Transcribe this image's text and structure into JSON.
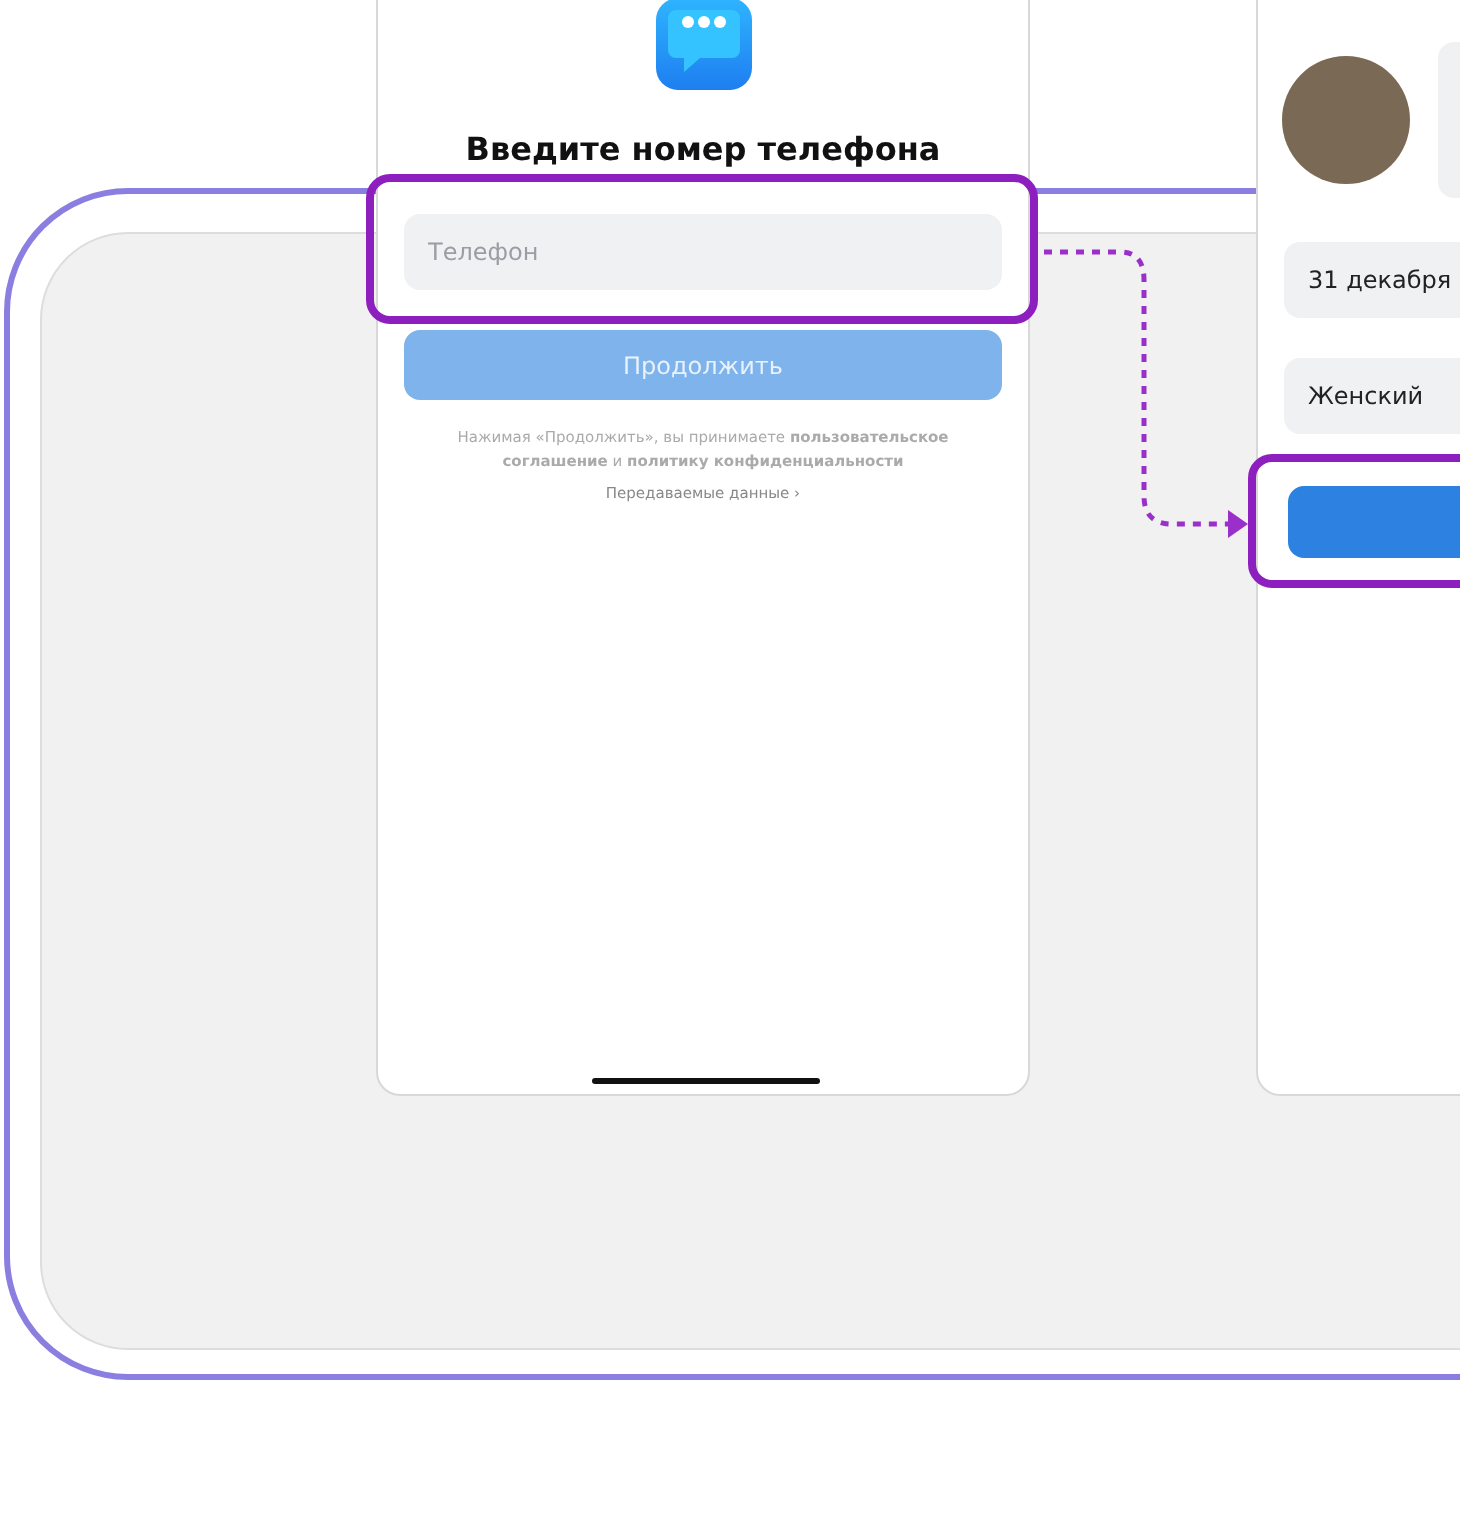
{
  "left_screen": {
    "title": "Введите номер телефона",
    "phone_field": {
      "placeholder": "Телефон",
      "highlighted": true
    },
    "continue_button": {
      "label": "Продолжить",
      "disabled": true
    },
    "legal_text": "Нажимая «Продолжить», вы принимаете **пользовательское соглашение** и **политику конфиденциальности**",
    "data_link": "Передаваемые данные ›"
  },
  "right_screen": {
    "birth_date_field": {
      "value": "31 декабря"
    },
    "gender_field": {
      "value": "Женский"
    },
    "submit_button": {
      "highlighted": true
    }
  }
}
